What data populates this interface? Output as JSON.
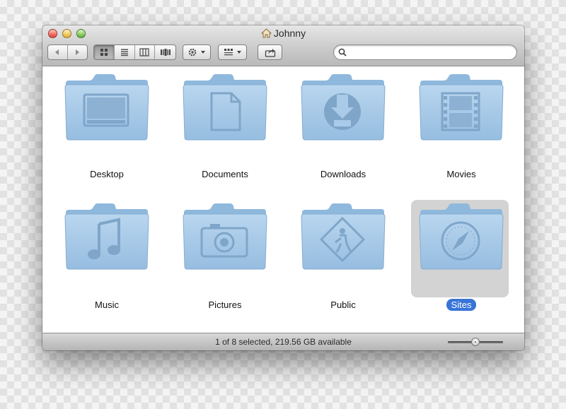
{
  "window": {
    "title": "Johnny",
    "title_icon": "home-icon"
  },
  "toolbar": {
    "nav": [
      {
        "icon": "back-arrow-icon"
      },
      {
        "icon": "forward-arrow-icon"
      }
    ],
    "view_modes": [
      {
        "name": "icon-view",
        "icon": "grid-icon",
        "active": true
      },
      {
        "name": "list-view",
        "icon": "list-icon",
        "active": false
      },
      {
        "name": "column-view",
        "icon": "columns-icon",
        "active": false
      },
      {
        "name": "cover-flow-view",
        "icon": "coverflow-icon",
        "active": false
      }
    ],
    "action_icon": "gear-icon",
    "arrange_icon": "arrange-icon",
    "share_icon": "share-icon",
    "search": {
      "placeholder": "",
      "value": "",
      "icon": "search-icon"
    }
  },
  "folders": [
    {
      "label": "Desktop",
      "icon": "desktop-icon",
      "selected": false
    },
    {
      "label": "Documents",
      "icon": "document-icon",
      "selected": false
    },
    {
      "label": "Downloads",
      "icon": "download-icon",
      "selected": false
    },
    {
      "label": "Movies",
      "icon": "film-icon",
      "selected": false
    },
    {
      "label": "Music",
      "icon": "music-note-icon",
      "selected": false
    },
    {
      "label": "Pictures",
      "icon": "camera-icon",
      "selected": false
    },
    {
      "label": "Public",
      "icon": "public-sign-icon",
      "selected": false
    },
    {
      "label": "Sites",
      "icon": "compass-icon",
      "selected": true
    }
  ],
  "status": {
    "text": "1 of 8 selected, 219.56 GB available",
    "icon_size_fraction": 0.5
  },
  "colors": {
    "folder": "#a9cae8",
    "selection": "#3874d8",
    "selection_bg": "#d3d3d3"
  }
}
